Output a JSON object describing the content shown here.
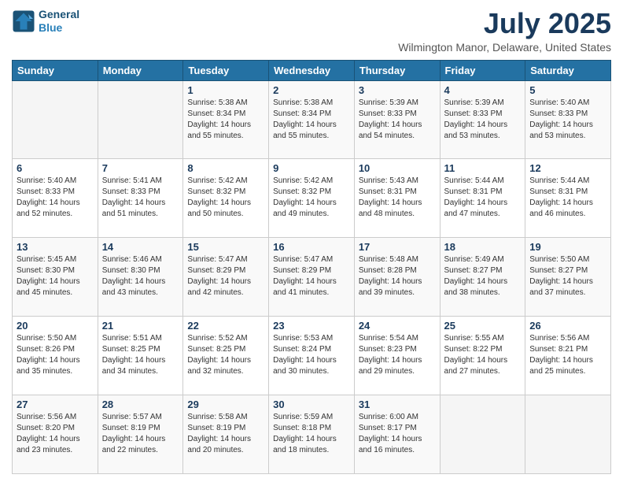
{
  "header": {
    "logo_line1": "General",
    "logo_line2": "Blue",
    "title": "July 2025",
    "subtitle": "Wilmington Manor, Delaware, United States"
  },
  "weekdays": [
    "Sunday",
    "Monday",
    "Tuesday",
    "Wednesday",
    "Thursday",
    "Friday",
    "Saturday"
  ],
  "weeks": [
    [
      {
        "day": "",
        "detail": ""
      },
      {
        "day": "",
        "detail": ""
      },
      {
        "day": "1",
        "detail": "Sunrise: 5:38 AM\nSunset: 8:34 PM\nDaylight: 14 hours and 55 minutes."
      },
      {
        "day": "2",
        "detail": "Sunrise: 5:38 AM\nSunset: 8:34 PM\nDaylight: 14 hours and 55 minutes."
      },
      {
        "day": "3",
        "detail": "Sunrise: 5:39 AM\nSunset: 8:33 PM\nDaylight: 14 hours and 54 minutes."
      },
      {
        "day": "4",
        "detail": "Sunrise: 5:39 AM\nSunset: 8:33 PM\nDaylight: 14 hours and 53 minutes."
      },
      {
        "day": "5",
        "detail": "Sunrise: 5:40 AM\nSunset: 8:33 PM\nDaylight: 14 hours and 53 minutes."
      }
    ],
    [
      {
        "day": "6",
        "detail": "Sunrise: 5:40 AM\nSunset: 8:33 PM\nDaylight: 14 hours and 52 minutes."
      },
      {
        "day": "7",
        "detail": "Sunrise: 5:41 AM\nSunset: 8:33 PM\nDaylight: 14 hours and 51 minutes."
      },
      {
        "day": "8",
        "detail": "Sunrise: 5:42 AM\nSunset: 8:32 PM\nDaylight: 14 hours and 50 minutes."
      },
      {
        "day": "9",
        "detail": "Sunrise: 5:42 AM\nSunset: 8:32 PM\nDaylight: 14 hours and 49 minutes."
      },
      {
        "day": "10",
        "detail": "Sunrise: 5:43 AM\nSunset: 8:31 PM\nDaylight: 14 hours and 48 minutes."
      },
      {
        "day": "11",
        "detail": "Sunrise: 5:44 AM\nSunset: 8:31 PM\nDaylight: 14 hours and 47 minutes."
      },
      {
        "day": "12",
        "detail": "Sunrise: 5:44 AM\nSunset: 8:31 PM\nDaylight: 14 hours and 46 minutes."
      }
    ],
    [
      {
        "day": "13",
        "detail": "Sunrise: 5:45 AM\nSunset: 8:30 PM\nDaylight: 14 hours and 45 minutes."
      },
      {
        "day": "14",
        "detail": "Sunrise: 5:46 AM\nSunset: 8:30 PM\nDaylight: 14 hours and 43 minutes."
      },
      {
        "day": "15",
        "detail": "Sunrise: 5:47 AM\nSunset: 8:29 PM\nDaylight: 14 hours and 42 minutes."
      },
      {
        "day": "16",
        "detail": "Sunrise: 5:47 AM\nSunset: 8:29 PM\nDaylight: 14 hours and 41 minutes."
      },
      {
        "day": "17",
        "detail": "Sunrise: 5:48 AM\nSunset: 8:28 PM\nDaylight: 14 hours and 39 minutes."
      },
      {
        "day": "18",
        "detail": "Sunrise: 5:49 AM\nSunset: 8:27 PM\nDaylight: 14 hours and 38 minutes."
      },
      {
        "day": "19",
        "detail": "Sunrise: 5:50 AM\nSunset: 8:27 PM\nDaylight: 14 hours and 37 minutes."
      }
    ],
    [
      {
        "day": "20",
        "detail": "Sunrise: 5:50 AM\nSunset: 8:26 PM\nDaylight: 14 hours and 35 minutes."
      },
      {
        "day": "21",
        "detail": "Sunrise: 5:51 AM\nSunset: 8:25 PM\nDaylight: 14 hours and 34 minutes."
      },
      {
        "day": "22",
        "detail": "Sunrise: 5:52 AM\nSunset: 8:25 PM\nDaylight: 14 hours and 32 minutes."
      },
      {
        "day": "23",
        "detail": "Sunrise: 5:53 AM\nSunset: 8:24 PM\nDaylight: 14 hours and 30 minutes."
      },
      {
        "day": "24",
        "detail": "Sunrise: 5:54 AM\nSunset: 8:23 PM\nDaylight: 14 hours and 29 minutes."
      },
      {
        "day": "25",
        "detail": "Sunrise: 5:55 AM\nSunset: 8:22 PM\nDaylight: 14 hours and 27 minutes."
      },
      {
        "day": "26",
        "detail": "Sunrise: 5:56 AM\nSunset: 8:21 PM\nDaylight: 14 hours and 25 minutes."
      }
    ],
    [
      {
        "day": "27",
        "detail": "Sunrise: 5:56 AM\nSunset: 8:20 PM\nDaylight: 14 hours and 23 minutes."
      },
      {
        "day": "28",
        "detail": "Sunrise: 5:57 AM\nSunset: 8:19 PM\nDaylight: 14 hours and 22 minutes."
      },
      {
        "day": "29",
        "detail": "Sunrise: 5:58 AM\nSunset: 8:19 PM\nDaylight: 14 hours and 20 minutes."
      },
      {
        "day": "30",
        "detail": "Sunrise: 5:59 AM\nSunset: 8:18 PM\nDaylight: 14 hours and 18 minutes."
      },
      {
        "day": "31",
        "detail": "Sunrise: 6:00 AM\nSunset: 8:17 PM\nDaylight: 14 hours and 16 minutes."
      },
      {
        "day": "",
        "detail": ""
      },
      {
        "day": "",
        "detail": ""
      }
    ]
  ]
}
